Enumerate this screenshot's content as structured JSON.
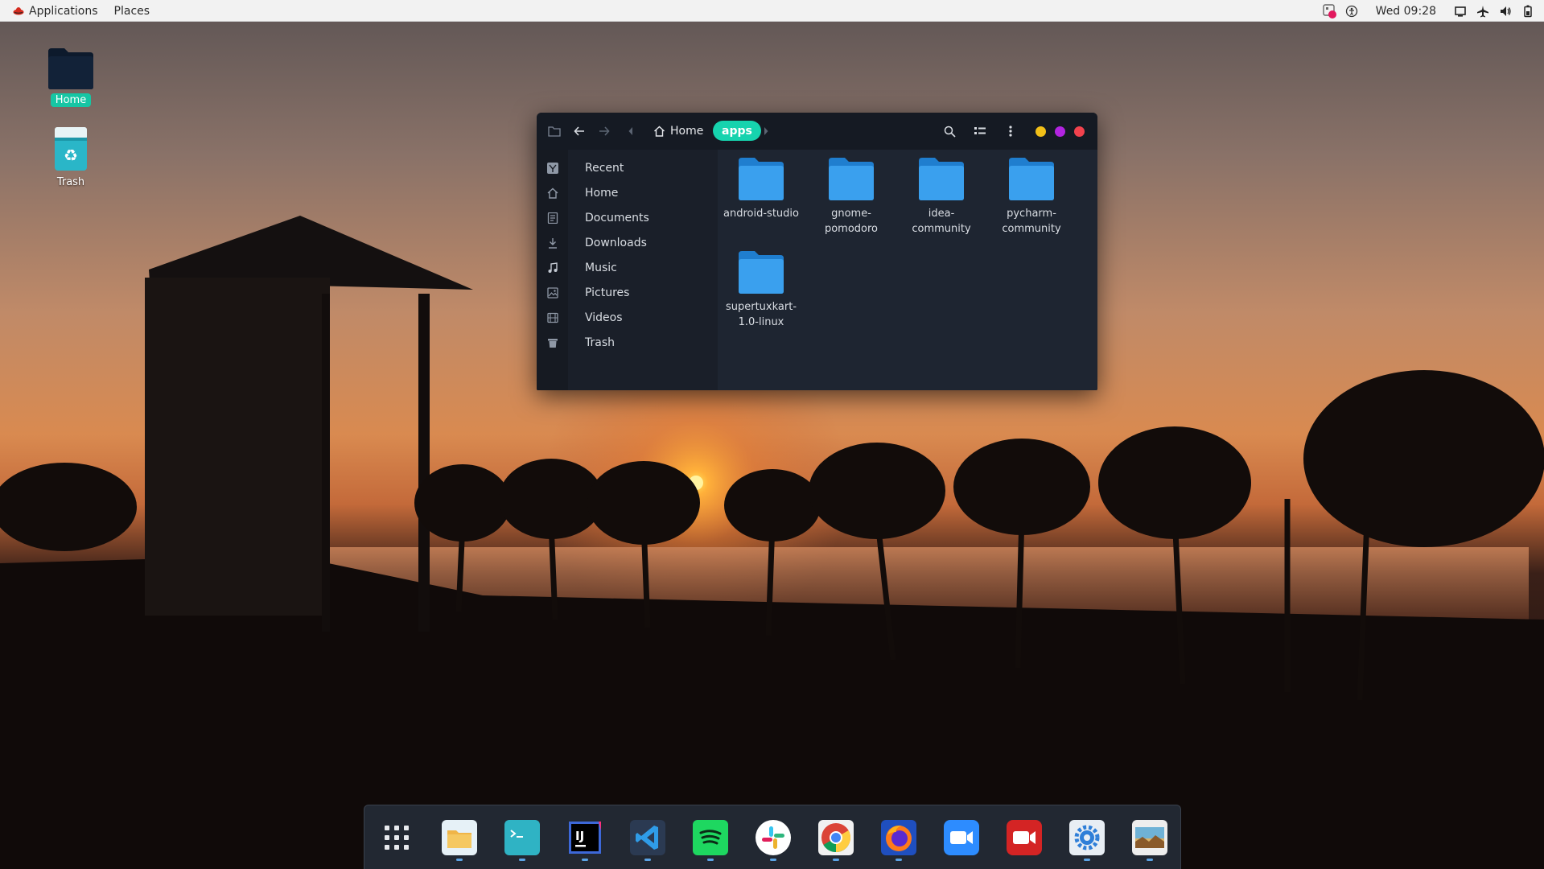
{
  "topbar": {
    "applications_label": "Applications",
    "places_label": "Places",
    "clock": "Wed 09:28"
  },
  "desktop": {
    "icons": [
      {
        "label": "Home",
        "icon": "folder-icon",
        "selected": true
      },
      {
        "label": "Trash",
        "icon": "trash-icon",
        "selected": false
      }
    ]
  },
  "file_manager": {
    "breadcrumb": {
      "home": "Home",
      "current": "apps"
    },
    "sidebar": [
      {
        "label": "Recent",
        "icon": "recent-icon"
      },
      {
        "label": "Home",
        "icon": "home-icon"
      },
      {
        "label": "Documents",
        "icon": "documents-icon"
      },
      {
        "label": "Downloads",
        "icon": "downloads-icon"
      },
      {
        "label": "Music",
        "icon": "music-icon"
      },
      {
        "label": "Pictures",
        "icon": "pictures-icon"
      },
      {
        "label": "Videos",
        "icon": "videos-icon"
      },
      {
        "label": "Trash",
        "icon": "trash-icon"
      }
    ],
    "folders": [
      {
        "label": "android-studio"
      },
      {
        "label": "gnome-pomodoro"
      },
      {
        "label": "idea-community"
      },
      {
        "label": "pycharm-community"
      },
      {
        "label": "supertuxkart-1.0-linux"
      }
    ],
    "window_controls": {
      "minimize_color": "#f2c018",
      "maximize_color": "#b224e0",
      "close_color": "#f2424d"
    },
    "accent": "#16d3ae"
  },
  "dock": {
    "apps": [
      {
        "name": "app-grid",
        "running": false
      },
      {
        "name": "files",
        "running": true
      },
      {
        "name": "terminal",
        "running": true
      },
      {
        "name": "intellij-idea",
        "running": true
      },
      {
        "name": "vscode",
        "running": true
      },
      {
        "name": "spotify",
        "running": true
      },
      {
        "name": "slack",
        "running": true
      },
      {
        "name": "chrome",
        "running": true
      },
      {
        "name": "firefox",
        "running": true
      },
      {
        "name": "zoom",
        "running": false
      },
      {
        "name": "screen-recorder",
        "running": false
      },
      {
        "name": "settings",
        "running": true
      },
      {
        "name": "image-viewer",
        "running": true
      }
    ]
  }
}
